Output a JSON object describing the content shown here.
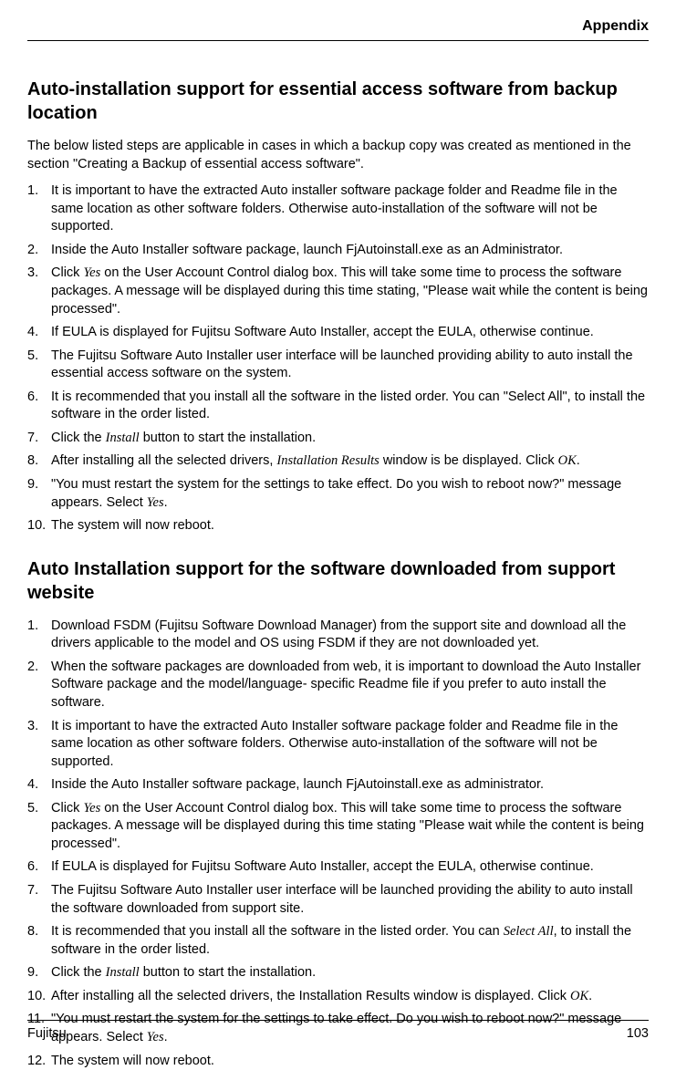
{
  "header": {
    "chapter": "Appendix"
  },
  "section1": {
    "title": "Auto-installation support for essential access software from backup location",
    "intro": "The below listed steps are applicable in cases in which a backup copy was created as mentioned in the section \"Creating a Backup of essential access software\".",
    "items": [
      {
        "num": "1.",
        "text": "It is important to have the extracted Auto installer software package folder and Readme file in the same location as other software folders. Otherwise auto-installation of the software will not be supported."
      },
      {
        "num": "2.",
        "text": "Inside the Auto Installer software package, launch FjAutoinstall.exe as an Administrator."
      },
      {
        "num": "3.",
        "pre": "Click ",
        "it1": "Yes",
        "post": " on the User Account Control dialog box. This will take some time to process the software packages. A message will be displayed during this time stating, \"Please wait while the content is being processed\"."
      },
      {
        "num": "4.",
        "text": "If EULA is displayed for Fujitsu Software Auto Installer, accept the EULA, otherwise continue."
      },
      {
        "num": "5.",
        "text": "The Fujitsu Software Auto Installer user interface will be launched providing ability to auto install the essential access software on the system."
      },
      {
        "num": "6.",
        "text": "It is recommended that you install all the software in the listed order. You can \"Select All\", to install the software in the order listed."
      },
      {
        "num": "7.",
        "pre": "Click the ",
        "it1": "Install",
        "post": " button to start the installation."
      },
      {
        "num": "8.",
        "pre": "After installing all the selected drivers, ",
        "it1": "Installation Results",
        "mid": " window is be displayed. Click ",
        "it2": "OK",
        "post": "."
      },
      {
        "num": "9.",
        "pre": "\"You must restart the system for the settings to take effect. Do you wish to reboot now?\" message appears. Select ",
        "it1": "Yes",
        "post": "."
      },
      {
        "num": "10.",
        "text": "The system will now reboot."
      }
    ]
  },
  "section2": {
    "title": "Auto Installation support for the software downloaded from support website",
    "items": [
      {
        "num": "1.",
        "text": "Download FSDM (Fujitsu Software Download Manager) from the support site and download all the drivers applicable to the model and OS using FSDM if they are not downloaded yet."
      },
      {
        "num": "2.",
        "text": "When the software packages are downloaded from web, it is important to download the Auto Installer Software package and the model/language- specific Readme file if you prefer to auto install the software."
      },
      {
        "num": "3.",
        "text": "It is important to have the extracted Auto Installer software package folder and Readme file in the same location as other software folders. Otherwise auto-installation of the software will not be supported."
      },
      {
        "num": "4.",
        "text": "Inside the Auto Installer software package, launch FjAutoinstall.exe as administrator."
      },
      {
        "num": "5.",
        "pre": "Click ",
        "it1": "Yes",
        "post": " on the User Account Control dialog box. This will take some time to process the software packages. A message will be displayed during this time stating \"Please wait while the content is being processed\"."
      },
      {
        "num": "6.",
        "text": "If EULA is displayed for Fujitsu Software Auto Installer, accept the EULA, otherwise continue."
      },
      {
        "num": "7.",
        "text": "The Fujitsu Software Auto Installer user interface will be launched providing the ability to auto install the software downloaded from support site."
      },
      {
        "num": "8.",
        "pre": "It is recommended that you install all the software in the listed order. You can ",
        "it1": "Select All",
        "post": ", to install the software in the order listed."
      },
      {
        "num": "9.",
        "pre": "Click the ",
        "it1": "Install",
        "post": " button to start the installation."
      },
      {
        "num": "10.",
        "pre": "After installing all the selected drivers, the Installation Results window is displayed. Click ",
        "it1": "OK",
        "post": "."
      },
      {
        "num": "11.",
        "pre": "\"You must restart the system for the settings to take effect. Do you wish to reboot now?\" message appears. Select ",
        "it1": "Yes",
        "post": "."
      },
      {
        "num": "12.",
        "text": "The system will now reboot."
      }
    ]
  },
  "footer": {
    "brand": "Fujitsu",
    "page": "103"
  }
}
